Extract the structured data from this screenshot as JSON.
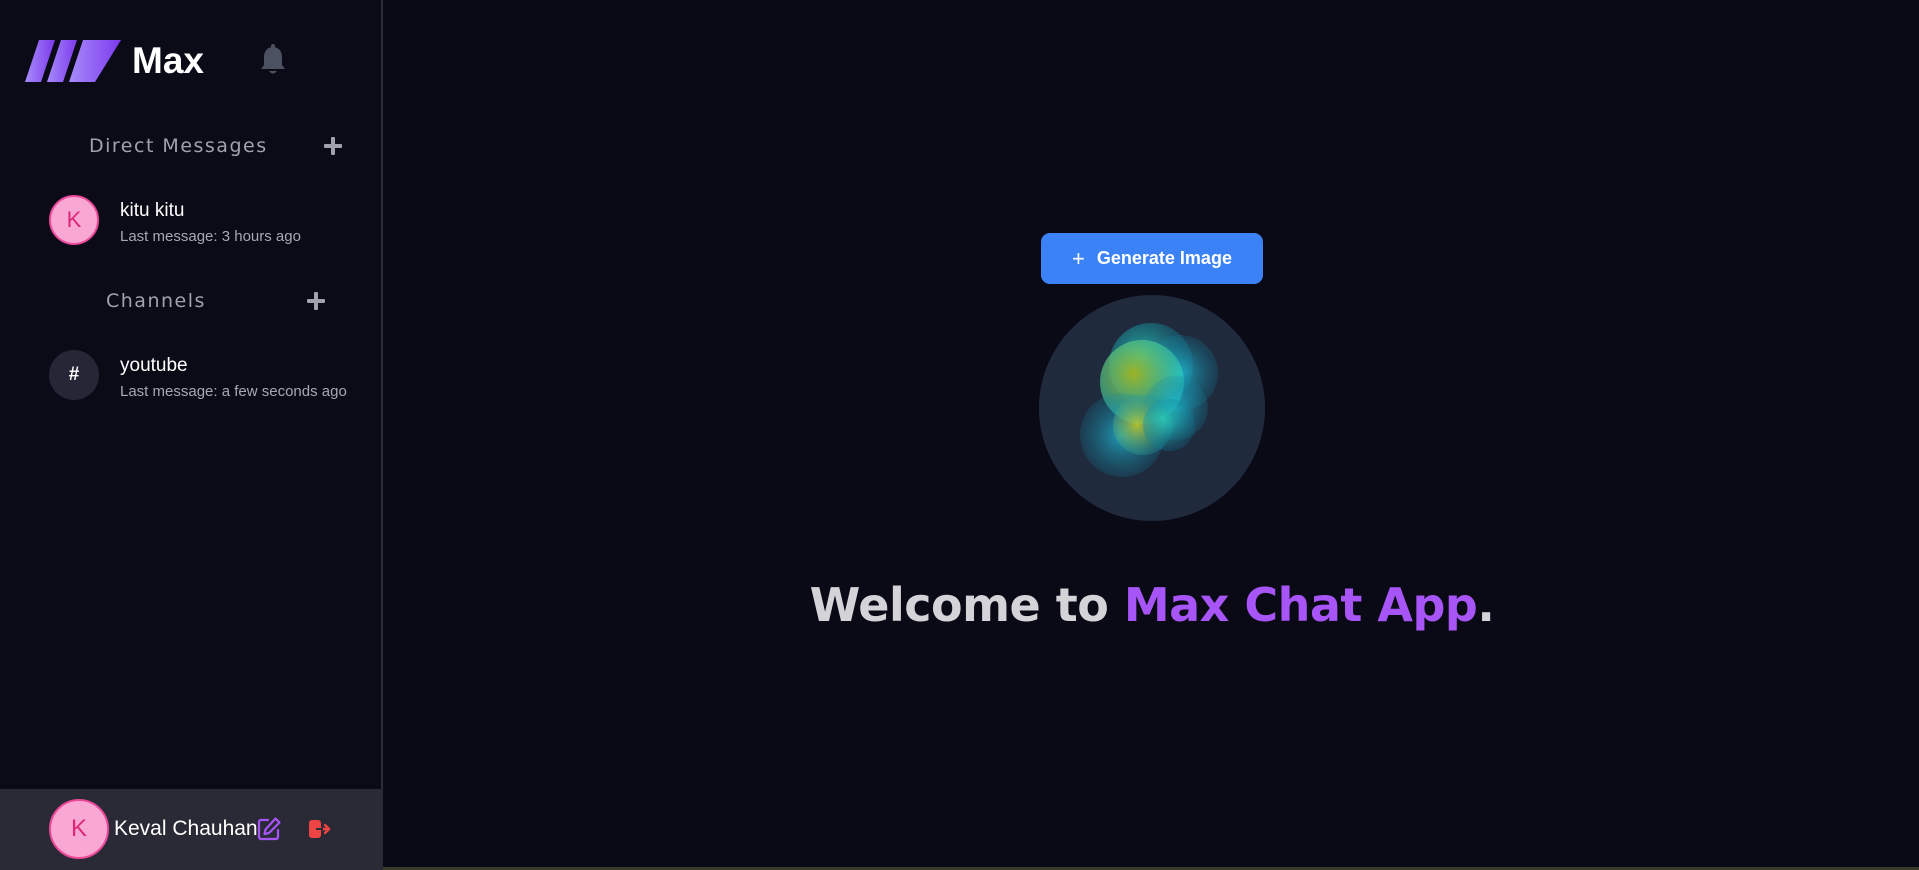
{
  "brand": {
    "name": "Max"
  },
  "sections": {
    "direct_messages": "Direct Messages",
    "channels": "Channels"
  },
  "direct_messages": [
    {
      "avatar_letter": "K",
      "name": "kitu kitu",
      "meta": "Last message: 3 hours ago"
    }
  ],
  "channels": [
    {
      "avatar_symbol": "#",
      "name": "youtube",
      "meta": "Last message: a few seconds ago"
    }
  ],
  "user": {
    "avatar_letter": "K",
    "name": "Keval Chauhan"
  },
  "main": {
    "generate_button": "Generate Image",
    "generate_icon": "+",
    "welcome_prefix": "Welcome to ",
    "welcome_accent": "Max Chat App",
    "welcome_suffix": "."
  },
  "icons": {
    "bell": "bell-icon",
    "add": "plus-icon",
    "edit": "edit-icon",
    "logout": "logout-icon"
  },
  "colors": {
    "accent_purple": "#a855f7",
    "primary_blue": "#3b82f6",
    "avatar_pink": "#f9a8d4",
    "logout_red": "#ef4444"
  }
}
